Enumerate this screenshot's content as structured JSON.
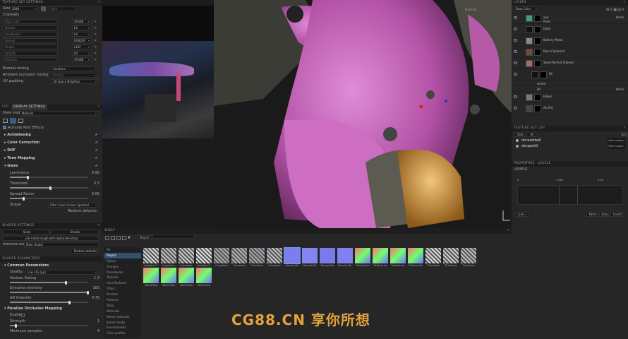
{
  "texture_set_settings": {
    "title": "TEXTURE SET SETTINGS",
    "size_label": "Size",
    "size_value": "2048",
    "channels_label": "Channels",
    "channels": [
      {
        "name": "Base color",
        "format": "sRGB8"
      },
      {
        "name": "Metallic",
        "format": "L8"
      },
      {
        "name": "Roughness",
        "format": "L8"
      },
      {
        "name": "Normal",
        "format": "RGB16F"
      },
      {
        "name": "Height",
        "format": "L16F"
      },
      {
        "name": "Opacity",
        "format": "L8"
      },
      {
        "name": "Emissive",
        "format": "sRGB8"
      }
    ],
    "normal_mixing_label": "Normal mixing",
    "normal_mixing_value": "Combine",
    "ao_mixing_label": "Ambient occlusion mixing",
    "ao_mixing_value": "Multiply",
    "uv_padding_label": "UV padding",
    "uv_padding_value": "3D Space Neighbor"
  },
  "display_settings": {
    "tabs": [
      "LOG",
      "DISPLAY SETTINGS"
    ],
    "view_mode_label": "View mode",
    "view_mode_value": "Material",
    "activate_post_effects": "Activate Post Effects",
    "sections": [
      "Antialiasing",
      "Color Correction",
      "DOF",
      "Tone Mapping",
      "Glare"
    ],
    "glare": {
      "luminance_label": "Luminance",
      "luminance_value": "0.95",
      "threshold_label": "Threshold",
      "threshold_value": "0.5",
      "spread_label": "Spread Factor",
      "spread_value": "0.05",
      "shape_label": "Shape",
      "shape_value": "Filter Cross Screen Spectral"
    },
    "restore_defaults": "Restore defaults"
  },
  "shader_settings": {
    "title": "SHADER SETTINGS",
    "buttons": [
      "Scale",
      "Shader"
    ],
    "shader_name": "pbr-metal-rough-with-alpha-blending",
    "instance_label": "Instance name",
    "instance_value": "Main shader",
    "restore_defaults": "Restore defaults",
    "params_title": "SHADER PARAMETERS",
    "common_title": "Common Parameters",
    "quality_label": "Quality",
    "quality_value": "Low (16 spp)",
    "horizon_label": "Horizon Fading",
    "horizon_value": "1.3",
    "emissive_label": "Emissive Intensity",
    "emissive_value": "100",
    "ao_label": "AO Intensity",
    "ao_value": "0.75",
    "pom_title": "Parallax Occlusion Mapping",
    "enable_label": "Enable",
    "strength_label": "Strength",
    "strength_value": "1",
    "min_samples_label": "Minimum samples",
    "min_samples_value": "4"
  },
  "viewport": {
    "mode": "Material"
  },
  "layers": {
    "title": "LAYERS",
    "channel": "Base Color",
    "items": [
      {
        "name": "eye",
        "sub": "Paint",
        "mode": "Norm"
      },
      {
        "name": "black"
      },
      {
        "name": "Battery Metal"
      },
      {
        "name": "Base Clipboard"
      },
      {
        "name": "Steel Painted Stained"
      },
      {
        "name": "Pit"
      },
      {
        "name": "Levels"
      },
      {
        "name": "Fill",
        "mode": "Norm"
      },
      {
        "name": "Edges"
      },
      {
        "name": "Ao Dirt"
      }
    ]
  },
  "texture_set_list": {
    "title": "TEXTURE SET LIST",
    "buttons": [
      "Solo",
      "All"
    ],
    "items": [
      {
        "name": "dvrasetball",
        "shader": "Main shader"
      },
      {
        "name": "dvrapistil",
        "shader": "Main shader"
      }
    ],
    "right_btn": "Sett"
  },
  "properties": {
    "title": "PROPERTIES - LEVELS",
    "levels_label": "LEVELS",
    "markers": [
      "0",
      "1.000",
      "0.00"
    ],
    "channel": "Lum",
    "buttons": [
      "Paste",
      "Auto",
      "Invert"
    ]
  },
  "shelf": {
    "title": "SHELF",
    "filter_tag": "Project",
    "search_placeholder": "",
    "categories": [
      "All",
      "Project",
      "Alphas",
      "Grunges",
      "Procedurals",
      "Textures",
      "Hard Surfaces",
      "Filters",
      "Brushes",
      "Particles",
      "Tools",
      "Materials",
      "Smart materials",
      "Smart masks",
      "Environments",
      "Color profiles"
    ],
    "tiles": [
      "Ambient O",
      "Curvature",
      "Curvature",
      "Ambient O",
      "Curvature",
      "Curvature",
      "Curvature",
      "Curvature",
      "Normal Ma",
      "Normal Ma",
      "Normal Ma",
      "Normal Ma",
      "Position ba",
      "Position ba",
      "Position ba",
      "Position ba",
      "Thickness",
      "Thickness",
      "Thickness",
      "World Spa",
      "World Spa",
      "World Spa",
      "World Spa"
    ]
  },
  "watermark": "CG88.CN 享你所想",
  "colors": {
    "accent": "#34506e",
    "pink": "#c86ab4",
    "gold": "#e3a23b"
  }
}
